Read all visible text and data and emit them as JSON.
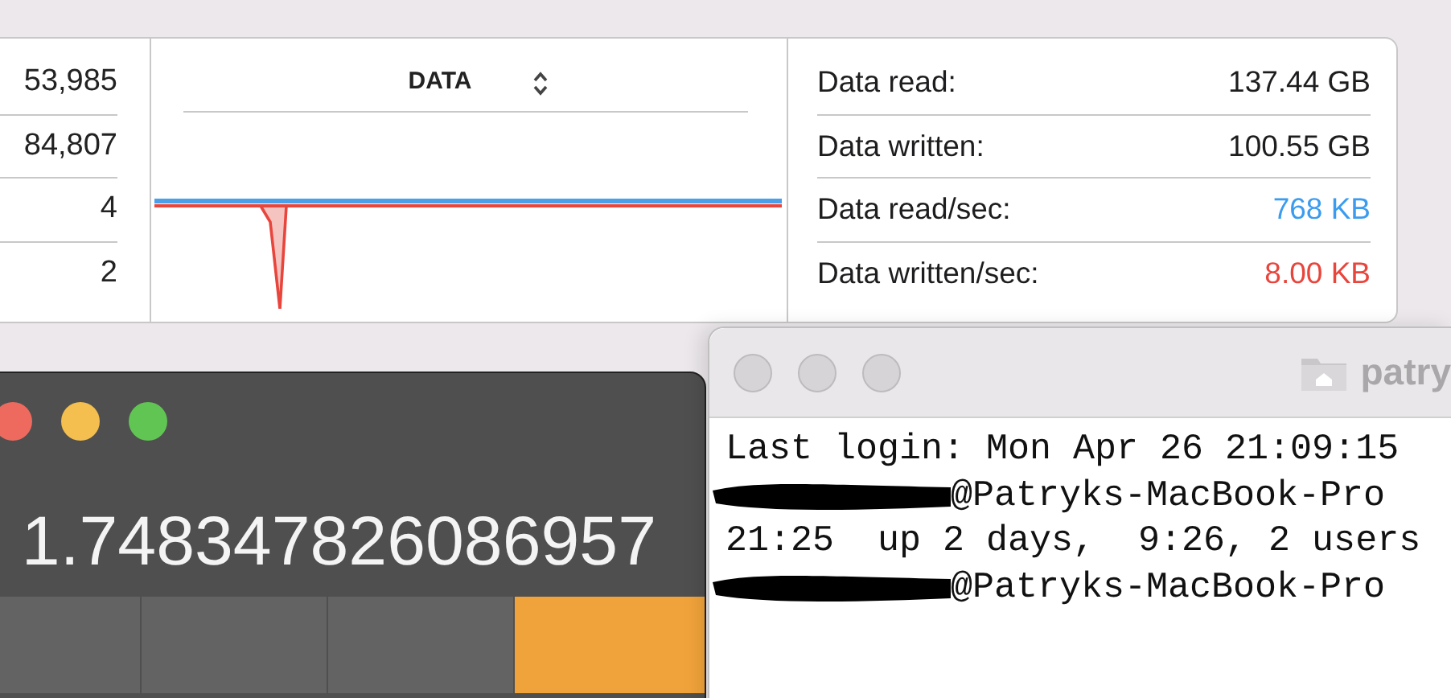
{
  "activity_monitor": {
    "left_column": [
      "53,985",
      "84,807",
      "4",
      "2"
    ],
    "chart": {
      "header": "DATA"
    },
    "stats": [
      {
        "label": "Data read:",
        "value": "137.44 GB",
        "color": "#1d1d1f"
      },
      {
        "label": "Data written:",
        "value": "100.55 GB",
        "color": "#1d1d1f"
      },
      {
        "label": "Data read/sec:",
        "value": "768 KB",
        "color": "#3b9cef"
      },
      {
        "label": "Data written/sec:",
        "value": "8.00 KB",
        "color": "#e8453c"
      }
    ]
  },
  "calculator": {
    "display": "1.748347826086957",
    "buttons": [
      {
        "kind": "function"
      },
      {
        "kind": "function"
      },
      {
        "kind": "function"
      },
      {
        "kind": "operator"
      }
    ]
  },
  "terminal": {
    "title": "patry",
    "lines": [
      {
        "text": "Last login: Mon Apr 26 21:09:15",
        "redacted": false
      },
      {
        "text": "@Patryks-MacBook-Pro",
        "redacted": true
      },
      {
        "text": "21:25  up 2 days,  9:26, 2 users",
        "redacted": false
      },
      {
        "text": "@Patryks-MacBook-Pro",
        "redacted": true
      }
    ]
  }
}
